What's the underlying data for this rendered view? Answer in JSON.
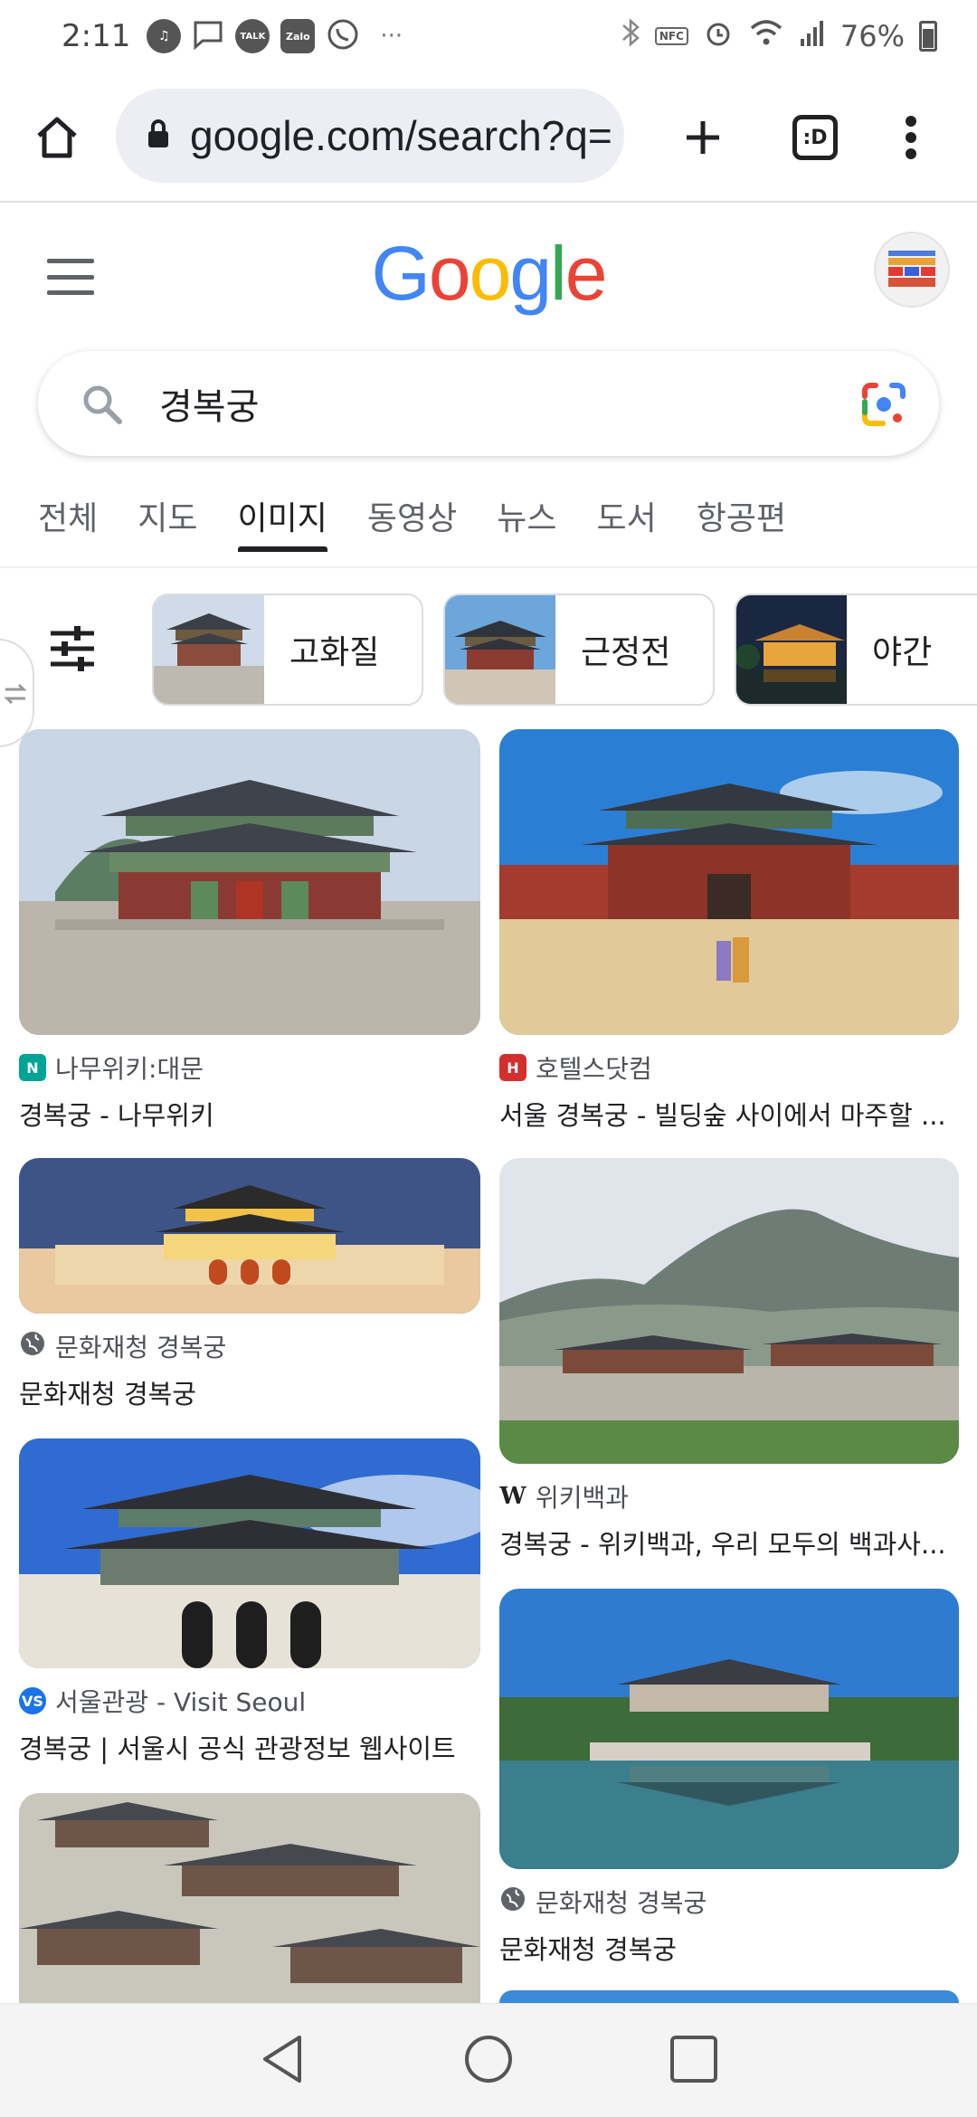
{
  "status_bar": {
    "time": "2:11",
    "notification_icons": [
      "music-icon",
      "message-icon",
      "kakaotalk-icon",
      "zalo-icon",
      "whatsapp-icon"
    ],
    "talk_label": "TALK",
    "zalo_label": "Zalo",
    "more": "···",
    "nfc_label": "NFC",
    "battery": "76%"
  },
  "browser": {
    "url": "google.com/search?q=",
    "tab_switcher_label": ":D"
  },
  "google": {
    "logo_letters": [
      {
        "char": "G",
        "color": "#4285F4"
      },
      {
        "char": "o",
        "color": "#EA4335"
      },
      {
        "char": "o",
        "color": "#FBBC05"
      },
      {
        "char": "g",
        "color": "#4285F4"
      },
      {
        "char": "l",
        "color": "#34A853"
      },
      {
        "char": "e",
        "color": "#EA4335"
      }
    ]
  },
  "search": {
    "query": "경복궁"
  },
  "tabs": [
    {
      "label": "전체",
      "active": false
    },
    {
      "label": "지도",
      "active": false
    },
    {
      "label": "이미지",
      "active": true
    },
    {
      "label": "동영상",
      "active": false
    },
    {
      "label": "뉴스",
      "active": false
    },
    {
      "label": "도서",
      "active": false
    },
    {
      "label": "항공편",
      "active": false
    }
  ],
  "chips": [
    {
      "label": "고화질"
    },
    {
      "label": "근정전"
    },
    {
      "label": "야간"
    }
  ],
  "results": [
    {
      "source": "나무위키:대문",
      "title": "경복궁 - 나무위키",
      "favicon": "namuwiki-icon",
      "favicon_color": "#00a495"
    },
    {
      "source": "호텔스닷컴",
      "title": "서울 경복궁 - 빌딩숲 사이에서 마주할 ...",
      "favicon": "hotels-icon",
      "favicon_color": "#d32f2f"
    },
    {
      "source": "문화재청 경복궁",
      "title": "문화재청 경복궁",
      "favicon": "globe-icon",
      "favicon_color": "#5f6368"
    },
    {
      "source": "위키백과",
      "title": "경복궁 - 위키백과, 우리 모두의 백과사...",
      "favicon": "wikipedia-icon",
      "favicon_color": "#202124"
    },
    {
      "source": "서울관광 - Visit Seoul",
      "title": "경복궁 | 서울시 공식 관광정보 웹사이트",
      "favicon": "visitseoul-icon",
      "favicon_color": "#1a73e8"
    },
    {
      "source": "문화재청 경복궁",
      "title": "문화재청 경복궁",
      "favicon": "globe-icon",
      "favicon_color": "#5f6368"
    }
  ]
}
